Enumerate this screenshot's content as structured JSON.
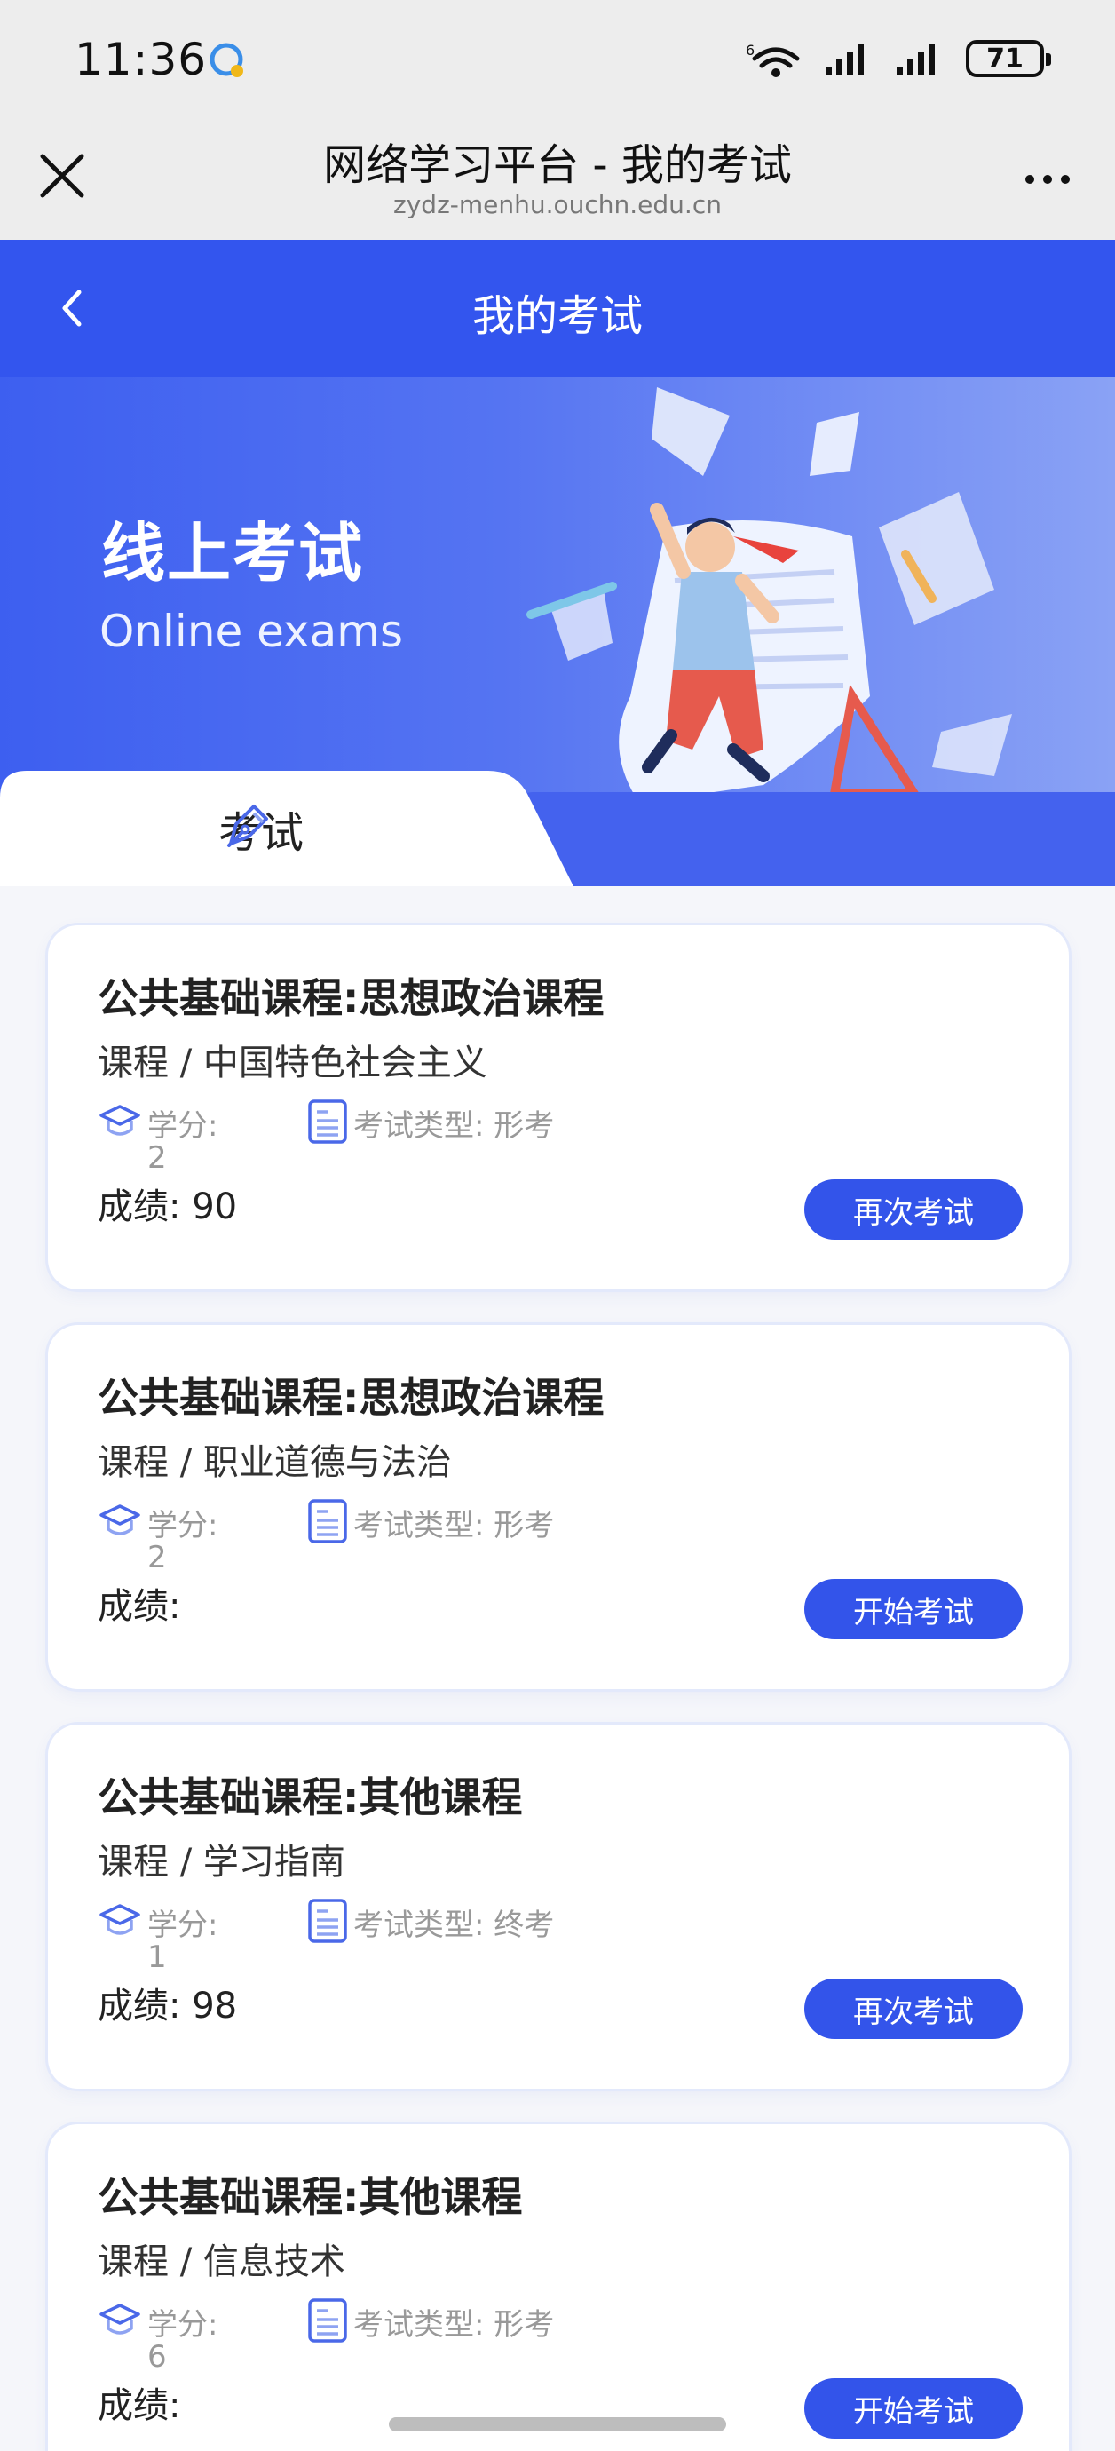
{
  "status_bar": {
    "time": "11:36",
    "battery": "71",
    "wifi_label": "6"
  },
  "browser": {
    "title": "网络学习平台 - 我的考试",
    "url": "zydz-menhu.ouchn.edu.cn"
  },
  "header": {
    "title": "我的考试"
  },
  "banner": {
    "title": "线上考试",
    "subtitle": "Online exams"
  },
  "tab": {
    "label": "考试"
  },
  "labels": {
    "credit": "学分:",
    "score_prefix": "成绩:",
    "exam_type_prefix": "考试类型:"
  },
  "exams": [
    {
      "title": "公共基础课程:思想政治课程",
      "path": "课程 / 中国特色社会主义",
      "credit": "2",
      "exam_type": "考试类型:  形考",
      "score": "成绩:  90",
      "action": "再次考试"
    },
    {
      "title": "公共基础课程:思想政治课程",
      "path": "课程 / 职业道德与法治",
      "credit": "2",
      "exam_type": "考试类型:  形考",
      "score": "成绩:",
      "action": "开始考试"
    },
    {
      "title": "公共基础课程:其他课程",
      "path": "课程 / 学习指南",
      "credit": "1",
      "exam_type": "考试类型:  终考",
      "score": "成绩:  98",
      "action": "再次考试"
    },
    {
      "title": "公共基础课程:其他课程",
      "path": "课程 / 信息技术",
      "credit": "6",
      "exam_type": "考试类型:  形考",
      "score": "成绩:",
      "action": "开始考试"
    }
  ],
  "colors": {
    "primary": "#3355ee",
    "button": "#3354ea",
    "chrome": "#ededed"
  }
}
